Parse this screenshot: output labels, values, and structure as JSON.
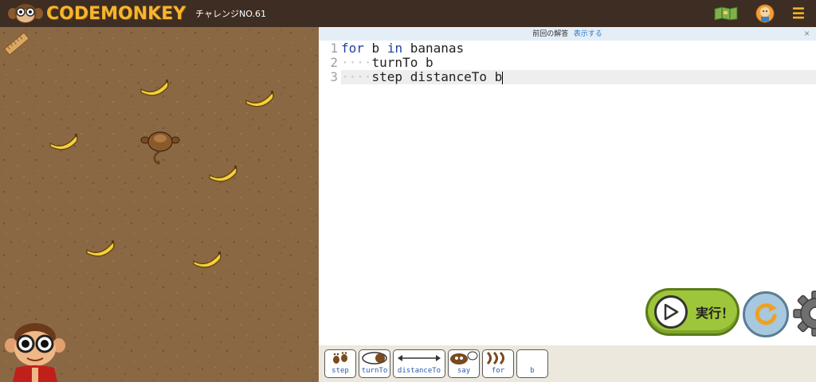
{
  "header": {
    "logo_text": "CODEMONKEY",
    "challenge": "チャレンジNO.61",
    "menu_icon": "☰"
  },
  "editor": {
    "prev_answer_label": "前回の解答",
    "prev_answer_link": "表示する",
    "close_icon": "×",
    "lines": [
      {
        "num": "1",
        "indent": "",
        "tokens": [
          {
            "kw": "for"
          },
          {
            "t": " b "
          },
          {
            "kw": "in"
          },
          {
            "t": " bananas"
          }
        ]
      },
      {
        "num": "2",
        "indent": "····",
        "tokens": [
          {
            "t": "turnTo b"
          }
        ]
      },
      {
        "num": "3",
        "indent": "····",
        "tokens": [
          {
            "t": "step distanceTo b"
          }
        ]
      }
    ]
  },
  "buttons": {
    "run_label": "実行！"
  },
  "toolbox": [
    {
      "label": "step",
      "icon": "feet-icon"
    },
    {
      "label": "turnTo",
      "icon": "turn-icon"
    },
    {
      "label": "distanceTo",
      "icon": "distance-arrow-icon"
    },
    {
      "label": "say",
      "icon": "speech-icon"
    },
    {
      "label": "for",
      "icon": "loop-icon"
    },
    {
      "label": "b",
      "icon": "variable"
    }
  ],
  "colors": {
    "accent": "#f7b52c",
    "keyword": "#1f3fa8",
    "run_button": "#9ec63a",
    "reset_button": "#a7c8de"
  }
}
